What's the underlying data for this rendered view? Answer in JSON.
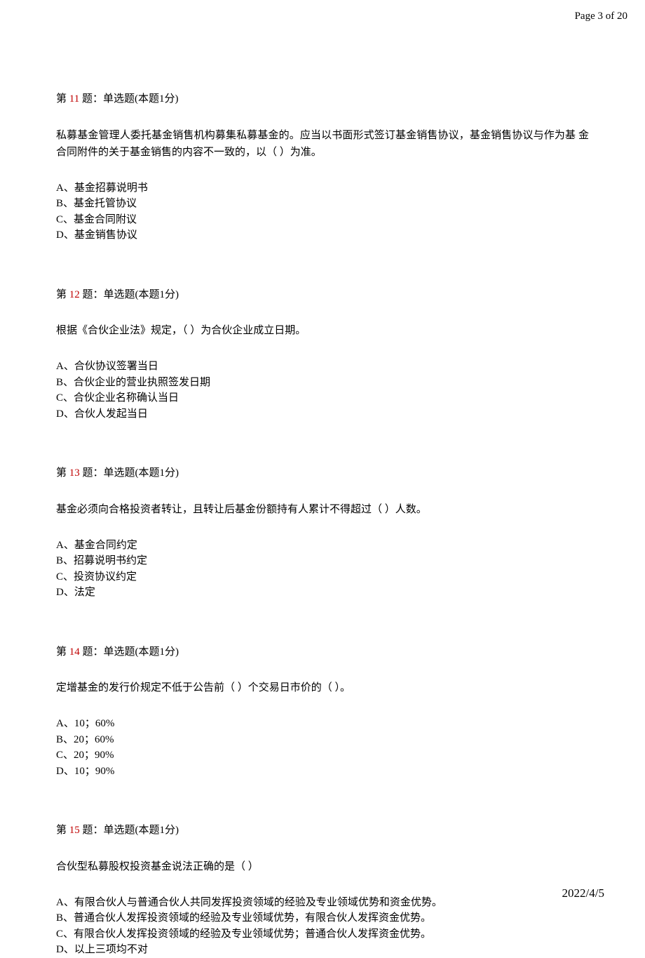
{
  "header": {
    "page_info": "Page 3 of 20"
  },
  "footer": {
    "date": "2022/4/5"
  },
  "questions": [
    {
      "prefix": "第 ",
      "number": "11",
      "suffix": " 题：单选题(本题1分)",
      "text": "私募基金管理人委托基金销售机构募集私募基金的。应当以书面形式签订基金销售协议，基金销售协议与作为基 金合同附件的关于基金销售的内容不一致的，以（ ）为准。",
      "options": [
        "A、基金招募说明书",
        "B、基金托管协议",
        "C、基金合同附议",
        "D、基金销售协议"
      ]
    },
    {
      "prefix": "第 ",
      "number": "12",
      "suffix": " 题：单选题(本题1分)",
      "text": "根据《合伙企业法》规定，（ ）为合伙企业成立日期。",
      "options": [
        "A、合伙协议签署当日",
        "B、合伙企业的营业执照签发日期",
        "C、合伙企业名称确认当日",
        "D、合伙人发起当日"
      ]
    },
    {
      "prefix": "第 ",
      "number": "13",
      "suffix": " 题：单选题(本题1分)",
      "text": "基金必须向合格投资者转让，且转让后基金份额持有人累计不得超过（ ）人数。",
      "options": [
        "A、基金合同约定",
        "B、招募说明书约定",
        "C、投资协议约定",
        "D、法定"
      ]
    },
    {
      "prefix": "第 ",
      "number": "14",
      "suffix": " 题：单选题(本题1分)",
      "text": "定增基金的发行价规定不低于公告前（ ）个交易日市价的（ ）。",
      "options": [
        "A、10；60%",
        "B、20；60%",
        "C、20；90%",
        "D、10；90%"
      ]
    },
    {
      "prefix": "第 ",
      "number": "15",
      "suffix": " 题：单选题(本题1分)",
      "text": "合伙型私募股权投资基金说法正确的是（ ）",
      "options": [
        "A、有限合伙人与普通合伙人共同发挥投资领域的经验及专业领域优势和资金优势。",
        "B、普通合伙人发挥投资领域的经验及专业领域优势，有限合伙人发挥资金优势。",
        "C、有限合伙人发挥投资领域的经验及专业领域优势；普通合伙人发挥资金优势。",
        "D、以上三项均不对"
      ]
    }
  ]
}
